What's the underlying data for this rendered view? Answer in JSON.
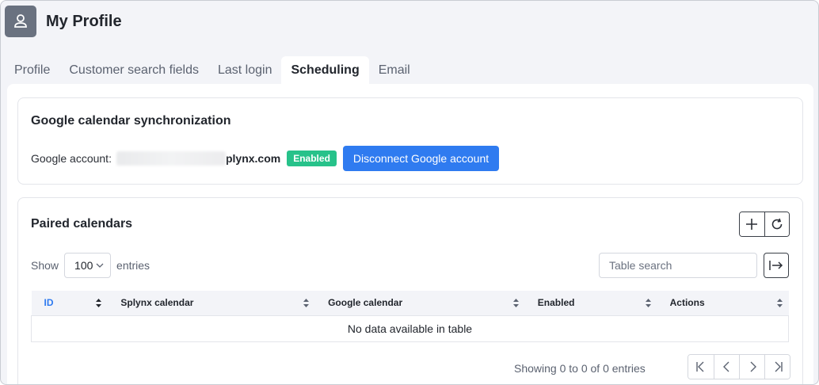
{
  "header": {
    "title": "My Profile",
    "avatar_icon": "user-icon"
  },
  "tabs": [
    {
      "label": "Profile",
      "active": false
    },
    {
      "label": "Customer search fields",
      "active": false
    },
    {
      "label": "Last login",
      "active": false
    },
    {
      "label": "Scheduling",
      "active": true
    },
    {
      "label": "Email",
      "active": false
    }
  ],
  "sync": {
    "title": "Google calendar synchronization",
    "account_label": "Google account:",
    "account_email_visible": "plynx.com",
    "status": "Enabled",
    "disconnect_label": "Disconnect Google account"
  },
  "paired": {
    "title": "Paired calendars",
    "add_icon": "plus-icon",
    "refresh_icon": "refresh-icon",
    "show_label": "Show",
    "entries_value": "100",
    "entries_label": "entries",
    "search_placeholder": "Table search",
    "columns": [
      "ID",
      "Splynx calendar",
      "Google calendar",
      "Enabled",
      "Actions"
    ],
    "empty_text": "No data available in table",
    "showing_text": "Showing 0 to 0 of 0 entries"
  },
  "colors": {
    "accent": "#2f7bf0",
    "enabled": "#27c28a",
    "avatar_bg": "#6a7280"
  }
}
